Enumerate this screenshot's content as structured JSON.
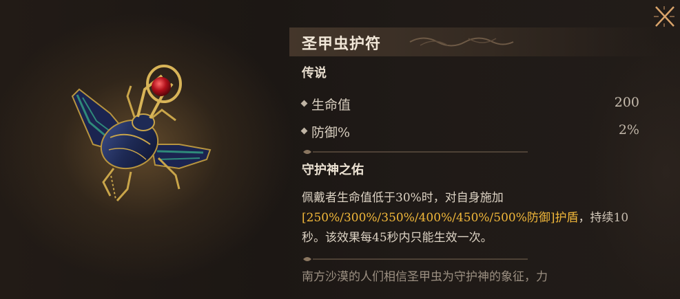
{
  "item": {
    "name": "圣甲虫护符",
    "rarity": "传说"
  },
  "stats": [
    {
      "label": "生命值",
      "value": "200"
    },
    {
      "label": "防御%",
      "value": "2%"
    }
  ],
  "skill": {
    "name": "守护神之佑",
    "desc_part1": "佩戴者生命值低于30%时，对自身施加",
    "desc_highlight": "[250%/300%/350%/400%/450%/500%防御]护盾",
    "desc_part2": "，持续10秒。该效果每45秒内只能生效一次。"
  },
  "lore": "南方沙漠的人们相信圣甲虫为守护神的象征，力",
  "icons": {
    "close": "close-x-icon",
    "stat_bullet": "diamond-bullet-icon",
    "artwork": "scarab-amulet-artwork"
  },
  "colors": {
    "highlight": "#f2b83a",
    "title": "#f1e7d8",
    "lore": "#9c9082"
  }
}
